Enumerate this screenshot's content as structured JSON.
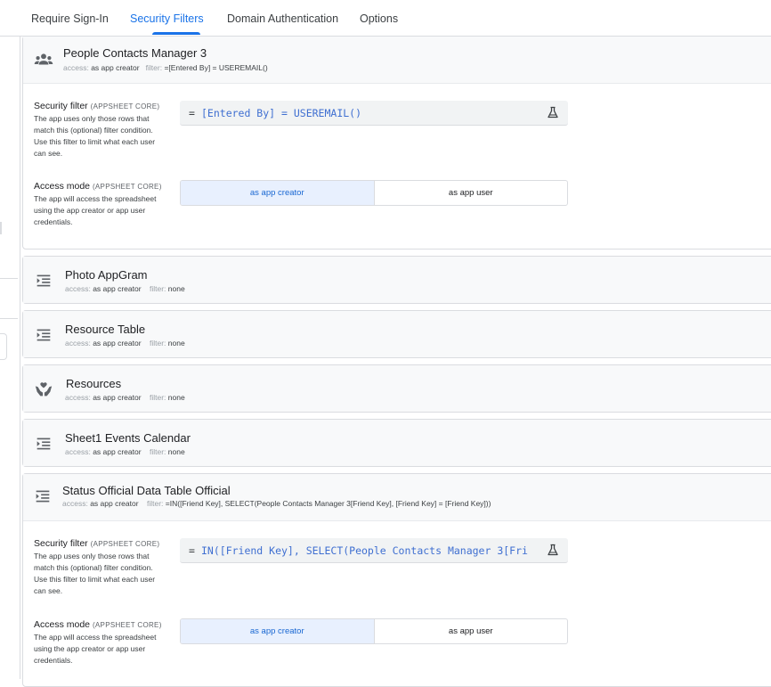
{
  "tabs": [
    {
      "label": "Require Sign-In"
    },
    {
      "label": "Security Filters"
    },
    {
      "label": "Domain Authentication"
    },
    {
      "label": "Options"
    }
  ],
  "active_tab": "Security Filters",
  "meta_keys": {
    "access": "access:",
    "filter": "filter:"
  },
  "section_labels": {
    "security_filter": "Security filter",
    "access_mode": "Access mode",
    "core_tag": "(APPSHEET CORE)",
    "security_filter_desc": "The app uses only those rows that match this (optional) filter condition. Use this filter to limit what each user can see.",
    "access_mode_desc": "The app will access the spreadsheet using the app creator or app user credentials."
  },
  "toggle_options": {
    "creator": "as app creator",
    "user": "as app user"
  },
  "formula_prefix": "=",
  "tables": [
    {
      "title": "People Contacts Manager 3",
      "access": "as app creator",
      "filter": "=[Entered By] = USEREMAIL()",
      "icon": "people-icon",
      "expanded": true,
      "formula": "[Entered By] = USEREMAIL()",
      "access_mode_selected": "as app creator"
    },
    {
      "title": "Photo AppGram",
      "access": "as app creator",
      "filter": "none",
      "icon": "list-indent-icon",
      "expanded": false
    },
    {
      "title": "Resource Table",
      "access": "as app creator",
      "filter": "none",
      "icon": "list-indent-icon",
      "expanded": false
    },
    {
      "title": "Resources",
      "access": "as app creator",
      "filter": "none",
      "icon": "hands-heart-icon",
      "expanded": false
    },
    {
      "title": "Sheet1 Events Calendar",
      "access": "as app creator",
      "filter": "none",
      "icon": "list-indent-icon",
      "expanded": false
    },
    {
      "title": "Status Official Data Table Official",
      "access": "as app creator",
      "filter": "=IN([Friend Key], SELECT(People Contacts Manager 3[Friend Key], [Friend Key] = [Friend Key]))",
      "icon": "list-indent-icon",
      "expanded": true,
      "formula": "IN([Friend Key], SELECT(People Contacts Manager 3[Fri",
      "access_mode_selected": "as app creator"
    }
  ],
  "colors": {
    "accent": "#1a73e8",
    "formula_text": "#3f6fd1",
    "toggle_selected_bg": "#e8f0fe"
  }
}
